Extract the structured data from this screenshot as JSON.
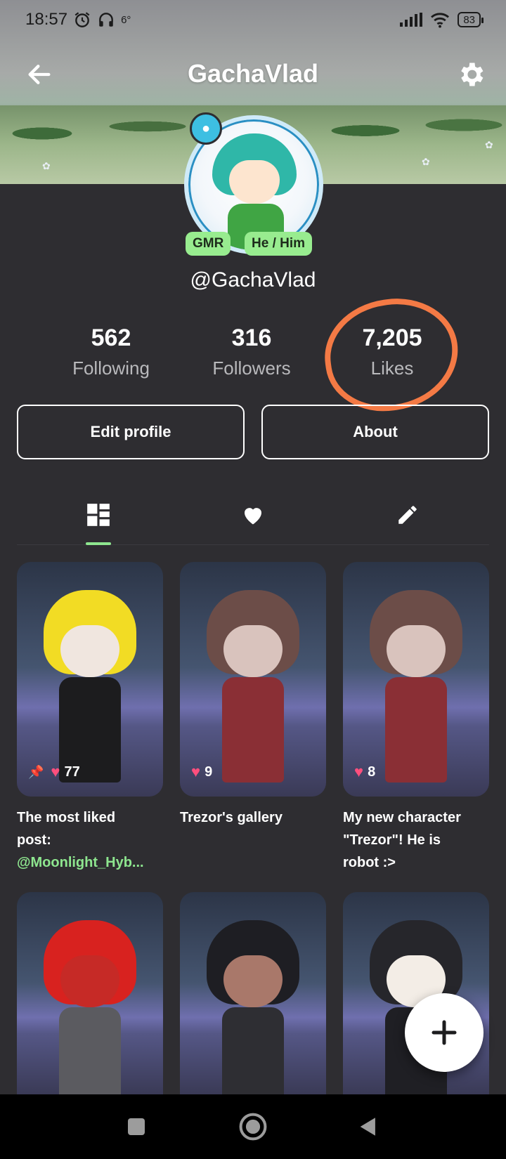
{
  "status_bar": {
    "time": "18:57",
    "alarm_icon": "alarm-icon",
    "headphones_icon": "headphones-icon",
    "temperature": "6°",
    "battery": "83"
  },
  "header": {
    "title": "GachaVlad",
    "back_icon": "arrow-left-icon",
    "settings_icon": "gear-icon"
  },
  "profile": {
    "badges": [
      "GMR",
      "He / Him"
    ],
    "handle": "@GachaVlad",
    "stats": [
      {
        "value": "562",
        "label": "Following"
      },
      {
        "value": "316",
        "label": "Followers"
      },
      {
        "value": "7,205",
        "label": "Likes"
      }
    ],
    "buttons": {
      "edit": "Edit profile",
      "about": "About"
    }
  },
  "tabs": [
    {
      "name": "posts",
      "icon": "grid-icon",
      "active": true
    },
    {
      "name": "liked",
      "icon": "heart-icon",
      "active": false
    },
    {
      "name": "drafts",
      "icon": "pencil-icon",
      "active": false
    }
  ],
  "posts": [
    {
      "likes": "77",
      "pinned": true,
      "caption_line1": "The most liked",
      "caption_line2": "post:",
      "caption_link": "@Moonlight_Hyb..."
    },
    {
      "likes": "9",
      "pinned": false,
      "caption_line1": "Trezor's gallery"
    },
    {
      "likes": "8",
      "pinned": false,
      "caption_line1": "My new character",
      "caption_line2": "\"Trezor\"! He is",
      "caption_line3": "robot :>"
    }
  ],
  "colors": {
    "background": "#2e2d31",
    "accent_green": "#8ee68f",
    "highlight_orange": "#f47a45",
    "like_pink": "#ff4f7d"
  }
}
